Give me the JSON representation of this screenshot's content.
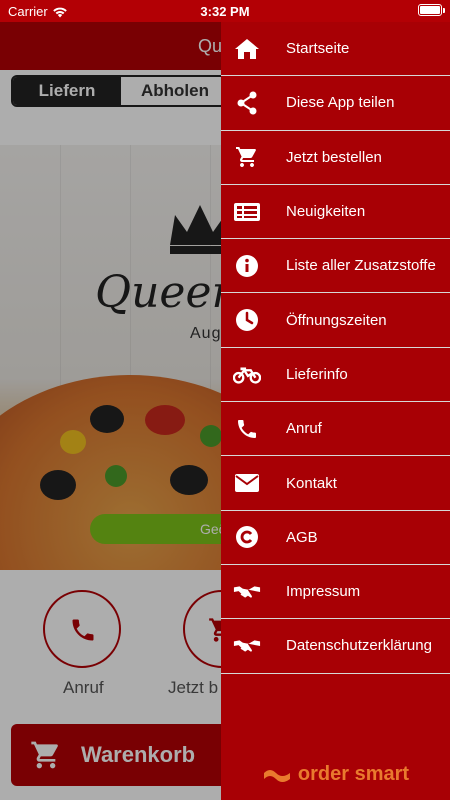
{
  "status_bar": {
    "carrier": "Carrier",
    "time": "3:32 PM"
  },
  "app": {
    "title": "Queen",
    "order_mode": {
      "options": [
        "Liefern",
        "Abholen"
      ],
      "selected": "Liefern"
    },
    "hero": {
      "name": "Queen'",
      "subtitle": "Aug",
      "geo_button": "Geö"
    },
    "actions": [
      {
        "label": "Anruf"
      },
      {
        "label": "Jetzt b"
      }
    ],
    "cart_button": "Warenkorb"
  },
  "drawer": {
    "items": [
      {
        "label": "Startseite",
        "icon": "home-icon"
      },
      {
        "label": "Diese App teilen",
        "icon": "share-icon"
      },
      {
        "label": "Jetzt bestellen",
        "icon": "cart-icon"
      },
      {
        "label": "Neuigkeiten",
        "icon": "news-icon"
      },
      {
        "label": "Liste aller Zusatzstoffe",
        "icon": "info-icon"
      },
      {
        "label": "Öffnungszeiten",
        "icon": "clock-icon"
      },
      {
        "label": "Lieferinfo",
        "icon": "motorcycle-icon"
      },
      {
        "label": "Anruf",
        "icon": "phone-icon"
      },
      {
        "label": "Kontakt",
        "icon": "mail-icon"
      },
      {
        "label": "AGB",
        "icon": "copyright-icon"
      },
      {
        "label": "Impressum",
        "icon": "handshake-icon"
      },
      {
        "label": "Datenschutzerklärung",
        "icon": "handshake-icon"
      }
    ],
    "brand": "order smart"
  },
  "colors": {
    "primary": "#b30005",
    "drawer": "#a80005",
    "accent_green": "#7cc21a",
    "brand_orange": "#e97a2e"
  }
}
